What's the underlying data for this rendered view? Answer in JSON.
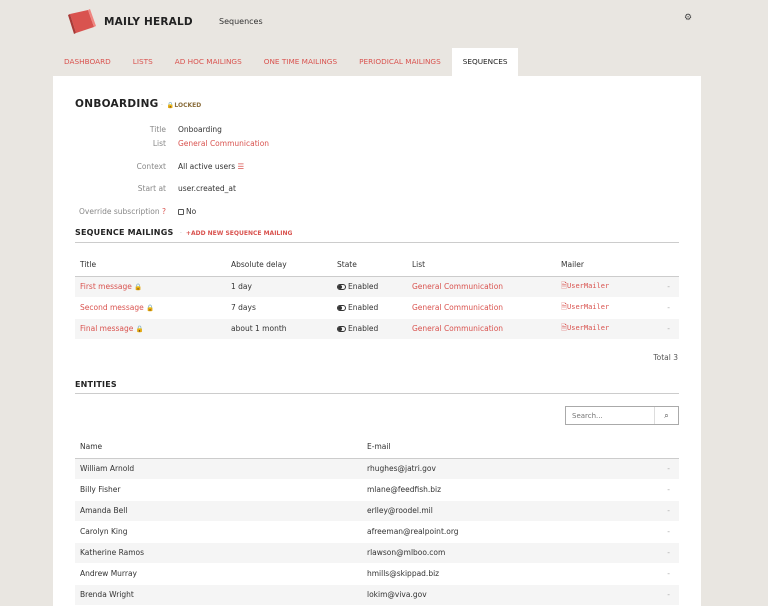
{
  "app": {
    "brand": "MAILY HERALD",
    "breadcrumb": "Sequences"
  },
  "colors": {
    "accent": "#d9534f",
    "panel": "#ffffff",
    "background": "#e9e6e1"
  },
  "nav": {
    "tabs": [
      "DASHBOARD",
      "LISTS",
      "AD HOC MAILINGS",
      "ONE TIME MAILINGS",
      "PERIODICAL MAILINGS",
      "SEQUENCES"
    ],
    "active": "SEQUENCES"
  },
  "sequence": {
    "name": "ONBOARDING",
    "locked_label": "LOCKED",
    "fields": {
      "title_label": "Title",
      "title_value": "Onboarding",
      "list_label": "List",
      "list_value": "General Communication",
      "context_label": "Context",
      "context_value": "All active users",
      "start_label": "Start at",
      "start_value": "user.created_at",
      "override_label": "Override subscription",
      "override_value": "No"
    }
  },
  "mailings": {
    "heading": "SEQUENCE MAILINGS",
    "add_label": "ADD NEW SEQUENCE MAILING",
    "columns": [
      "Title",
      "Absolute delay",
      "State",
      "List",
      "Mailer"
    ],
    "rows": [
      {
        "title": "First message",
        "delay": "1 day",
        "state": "Enabled",
        "list": "General Communication",
        "mailer": "UserMailer",
        "action": "-"
      },
      {
        "title": "Second message",
        "delay": "7 days",
        "state": "Enabled",
        "list": "General Communication",
        "mailer": "UserMailer",
        "action": "-"
      },
      {
        "title": "Final message",
        "delay": "about 1 month",
        "state": "Enabled",
        "list": "General Communication",
        "mailer": "UserMailer",
        "action": "-"
      }
    ],
    "total": "Total 3"
  },
  "entities": {
    "heading": "ENTITIES",
    "search_placeholder": "Search...",
    "columns": [
      "Name",
      "E-mail"
    ],
    "rows": [
      {
        "name": "William Arnold",
        "email": "rhughes@jatri.gov",
        "action": "-"
      },
      {
        "name": "Billy Fisher",
        "email": "mlane@feedfish.biz",
        "action": "-"
      },
      {
        "name": "Amanda Bell",
        "email": "erlley@roodel.mil",
        "action": "-"
      },
      {
        "name": "Carolyn King",
        "email": "afreeman@realpoint.org",
        "action": "-"
      },
      {
        "name": "Katherine Ramos",
        "email": "rlawson@mlboo.com",
        "action": "-"
      },
      {
        "name": "Andrew Murray",
        "email": "hmills@skippad.biz",
        "action": "-"
      },
      {
        "name": "Brenda Wright",
        "email": "lokim@viva.gov",
        "action": "-"
      }
    ]
  }
}
